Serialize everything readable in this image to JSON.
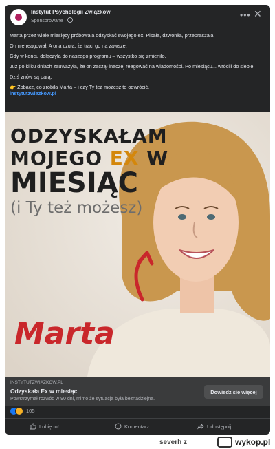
{
  "post": {
    "page_name": "Instytut Psychologii Związków",
    "sponsored_label": "Sponsorowane ·",
    "more_icon": "more-dots-icon",
    "close_icon": "close-icon",
    "paragraphs": [
      "Marta przez wiele miesięcy próbowała odzyskać swojego ex. Pisała, dzwoniła, przepraszała.",
      "On nie reagował. A ona czuła, że traci go na zawsze.",
      "Gdy w końcu dołączyła do naszego programu – wszystko się zmieniło.",
      "Już po kilku dniach zauważyła, że on zaczął inaczej reagować na wiadomości. Po miesiącu... wrócili do siebie.",
      "Dziś znów są parą."
    ],
    "cta_line": "👉 Zobacz, co zrobiła Marta – i czy Ty też możesz to odwrócić.",
    "link_text": "instytutzwiazkow.pl"
  },
  "ad_image": {
    "headline_1": "ODZYSKAŁAM",
    "headline_2a": "MOJEGO ",
    "headline_2b": "EX",
    "headline_2c": " W",
    "headline_3": "MIESIĄC",
    "subline": "(i Ty też możesz)",
    "name": "Marta",
    "accent_color": "#d4870b",
    "name_color": "#c9272b"
  },
  "link_preview": {
    "domain": "INSTYTUTZWIAZKOW.PL",
    "title": "Odzyskała Ex w miesiąc",
    "description": "Powstrzymał rozwód w 90 dni, mimo że sytuacja była beznadziejna.",
    "button_label": "Dowiedz się więcej"
  },
  "reactions": {
    "count": "105",
    "icons": [
      "like-icon",
      "haha-icon"
    ]
  },
  "actions": {
    "like": "Lubię to!",
    "comment": "Komentarz",
    "share": "Udostępnij"
  },
  "footer": {
    "user": "severh",
    "separator": "z",
    "brand": "wykop.pl"
  }
}
